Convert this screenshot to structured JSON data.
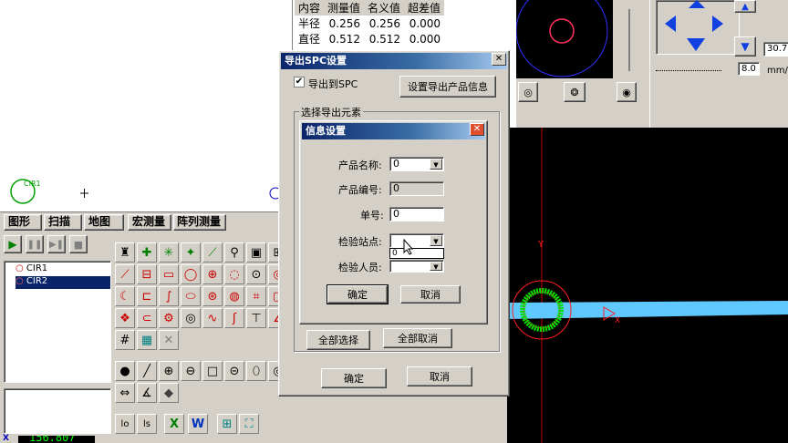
{
  "measure_table": {
    "headers": [
      "内容",
      "测量值",
      "名义值",
      "超差值"
    ],
    "rows": [
      [
        "半径",
        "0.256",
        "0.256",
        "0.000"
      ],
      [
        "直径",
        "0.512",
        "0.512",
        "0.000"
      ]
    ]
  },
  "left_panel": {
    "circle_label": "CIR1",
    "tabs": [
      "图形",
      "扫描",
      "地图",
      "宏测量",
      "阵列测量"
    ],
    "list_items": [
      "CIR1",
      "CIR2"
    ],
    "coord_readout": "156.807"
  },
  "right_panel": {
    "zoom_value": "30.7",
    "speed_value": "8.0",
    "unit": "mm/"
  },
  "spc_dialog": {
    "title": "导出SPC设置",
    "export_checkbox_label": "导出到SPC",
    "export_checked": true,
    "set_product_info_button": "设置导出产品信息",
    "group_label": "选择导出元素",
    "select_all_button": "全部选择",
    "deselect_all_button": "全部取消",
    "ok_button": "确定",
    "cancel_button": "取消"
  },
  "info_dialog": {
    "title": "信息设置",
    "product_name_label": "产品名称:",
    "product_name_value": "0",
    "product_code_label": "产品编号:",
    "product_code_value": "0",
    "order_label": "单号:",
    "order_value": "0",
    "station_label": "检验站点:",
    "station_dropdown_option": "0",
    "inspector_label": "检验人员:",
    "ok_button": "确定",
    "cancel_button": "取消"
  },
  "colors": {
    "title_gradient_start": "#0a246a",
    "camera_bg": "#000000",
    "beam": "#5ec8ff",
    "fit_circle": "#00e000",
    "target_circle": "#ff2020"
  }
}
